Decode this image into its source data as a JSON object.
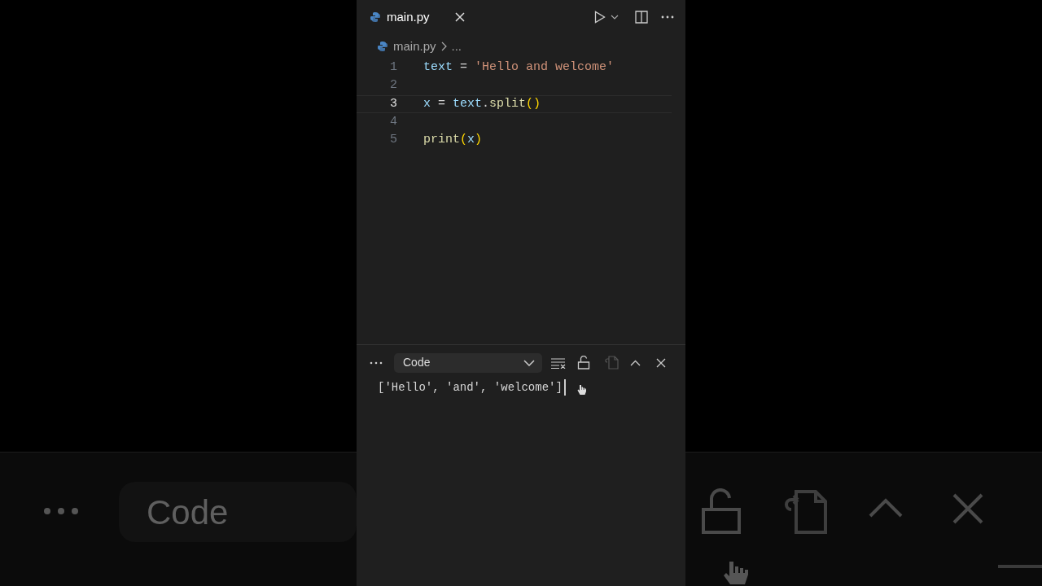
{
  "editor": {
    "tab": {
      "label": "main.py",
      "selected": true
    },
    "breadcrumb": {
      "file": "main.py",
      "more": "..."
    },
    "lines": [
      {
        "number": "1",
        "current": false,
        "tokens": [
          {
            "kind": "var",
            "text": "text"
          },
          {
            "kind": "op",
            "text": " = "
          },
          {
            "kind": "str",
            "text": "'Hello and welcome'"
          }
        ]
      },
      {
        "number": "2",
        "current": false
      },
      {
        "number": "3",
        "current": true,
        "tokens": [
          {
            "kind": "var",
            "text": "x"
          },
          {
            "kind": "op",
            "text": " = "
          },
          {
            "kind": "var",
            "text": "text"
          },
          {
            "kind": "op",
            "text": "."
          },
          {
            "kind": "fn",
            "text": "split"
          },
          {
            "kind": "paren",
            "text": "()"
          }
        ]
      },
      {
        "number": "4",
        "current": false
      },
      {
        "number": "5",
        "current": false,
        "tokens": [
          {
            "kind": "fn",
            "text": "print"
          },
          {
            "kind": "paren",
            "text": "("
          },
          {
            "kind": "var",
            "text": "x"
          },
          {
            "kind": "paren",
            "text": ")"
          }
        ]
      }
    ]
  },
  "output": {
    "channel": "Code",
    "text": "['Hello', 'and', 'welcome']"
  },
  "backdrop": {
    "channel": "Code"
  }
}
